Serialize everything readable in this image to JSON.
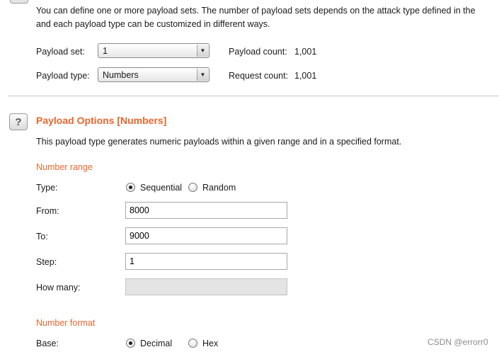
{
  "sets_section": {
    "description_line1": "You can define one or more payload sets. The number of payload sets depends on the attack type defined in the",
    "description_line2": "and each payload type can be customized in different ways.",
    "payload_set_label": "Payload set:",
    "payload_set_value": "1",
    "payload_count_label": "Payload count:",
    "payload_count_value": "1,001",
    "payload_type_label": "Payload type:",
    "payload_type_value": "Numbers",
    "request_count_label": "Request count:",
    "request_count_value": "1,001"
  },
  "options_section": {
    "icon": "help-icon",
    "icon_glyph": "?",
    "title": "Payload Options [Numbers]",
    "description": "This payload type generates numeric payloads within a given range and in a specified format.",
    "number_range_heading": "Number range",
    "type_label": "Type:",
    "type_options": [
      "Sequential",
      "Random"
    ],
    "type_selected": "Sequential",
    "from_label": "From:",
    "from_value": "8000",
    "to_label": "To:",
    "to_value": "9000",
    "step_label": "Step:",
    "step_value": "1",
    "how_many_label": "How many:",
    "how_many_value": "",
    "number_format_heading": "Number format",
    "base_label": "Base:",
    "base_options": [
      "Decimal",
      "Hex"
    ],
    "base_selected": "Decimal"
  },
  "watermark": "CSDN @errorr0",
  "colors": {
    "accent": "#e8662e",
    "divider": "#c8c8c8"
  }
}
